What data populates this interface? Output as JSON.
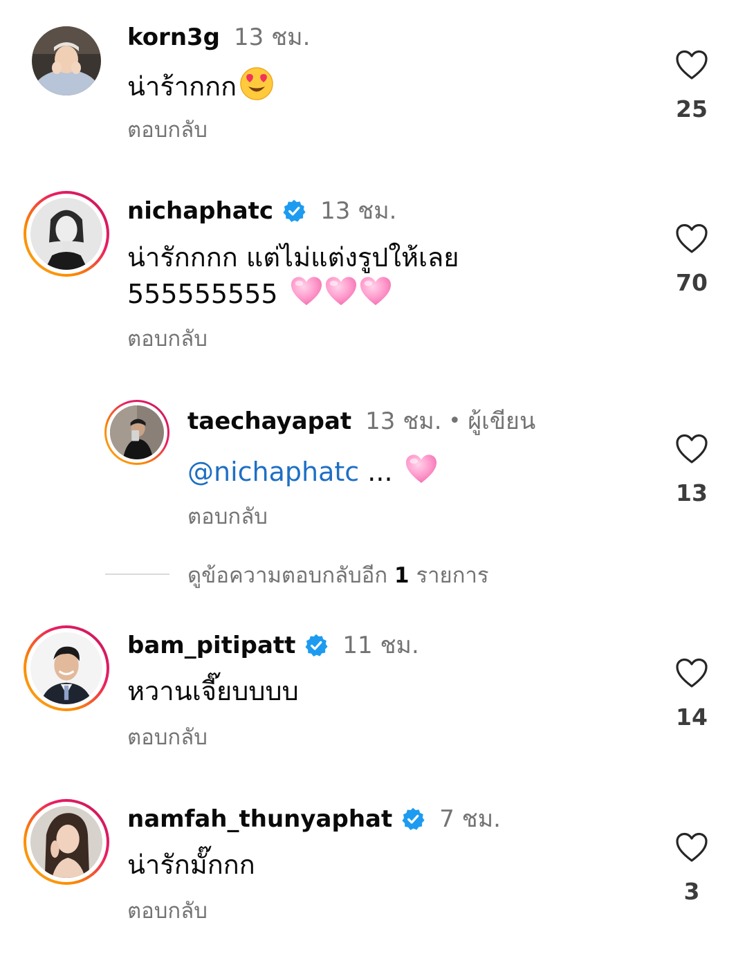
{
  "comments": [
    {
      "username": "korn3g",
      "time": "13 ชม.",
      "text": "น่าร้ากกก",
      "reply_label": "ตอบกลับ",
      "likes": "25",
      "verified": false,
      "story_ring": false
    },
    {
      "username": "nichaphatc",
      "time": "13 ชม.",
      "text_line1": "น่ารักกกก แต่ไม่แต่งรูปให้เลย",
      "text_line2": "555555555",
      "reply_label": "ตอบกลับ",
      "likes": "70",
      "verified": true,
      "story_ring": true
    },
    {
      "username": "taechayapat",
      "time": "13 ชม.",
      "dot": "•",
      "author_label": "ผู้เขียน",
      "mention": "@nichaphatc",
      "text": "...",
      "reply_label": "ตอบกลับ",
      "likes": "13",
      "verified": false,
      "story_ring": true
    },
    {
      "username": "bam_pitipatt",
      "time": "11 ชม.",
      "text": "หวานเจี๊ยบบบบ",
      "reply_label": "ตอบกลับ",
      "likes": "14",
      "verified": true,
      "story_ring": true
    },
    {
      "username": "namfah_thunyaphat",
      "time": "7 ชม.",
      "text": "น่ารักมั๊กกก",
      "reply_label": "ตอบกลับ",
      "likes": "3",
      "verified": true,
      "story_ring": true
    }
  ],
  "view_more": {
    "prefix": "ดูข้อความตอบกลับอีก",
    "count": "1",
    "suffix": "รายการ"
  },
  "colors": {
    "mention": "#1e6fc4",
    "verified": "#1d9bf0",
    "secondary_text": "#737373"
  },
  "icons": {
    "like": "heart-outline-icon",
    "verified": "verified-badge-icon",
    "emoji_heart_eyes": "heart-eyes-emoji",
    "emoji_pink_heart": "pink-heart-emoji"
  }
}
